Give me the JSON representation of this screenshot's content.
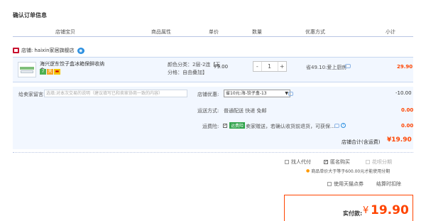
{
  "page": {
    "title": "确认订单信息"
  },
  "header": {
    "columns": [
      "店铺宝贝",
      "商品属性",
      "单价",
      "数量",
      "优惠方式",
      "小计"
    ]
  },
  "shop": {
    "label": "店铺:",
    "name": "haixin家居旗舰店"
  },
  "item": {
    "name": "海兴逻东饺子盒冰箱保鲜收纳盒...",
    "badges": [
      "7",
      "天",
      "▬"
    ],
    "attr": "颜色分类：2层-2连【无分格：自由叠加】",
    "price": "79.00",
    "qty": "1",
    "qty_minus": "-",
    "qty_plus": "+",
    "promo": "省49.10:爱上厨房",
    "subtotal": "29.90"
  },
  "options": {
    "message_label": "给卖家留言:",
    "message_placeholder": "选填:对本次交易的说明（建议填写已和卖家协商一致的内容）",
    "coupon_label": "店铺优惠:",
    "coupon_value": "省10元:海-饺子盒-13",
    "coupon_amount": "-10.00",
    "shipping_label": "运送方式:",
    "shipping_value": "普通配送 快递 免邮",
    "shipping_amount": "0.00",
    "insurance_label": "运费险:",
    "insurance_badge": "运费险",
    "insurance_text": "卖家赠送，若确认收货前退货，可获保...",
    "insurance_amount": "0.00",
    "insurance_help": "?"
  },
  "total": {
    "label": "店铺合计(含运费)",
    "value": "¥19.90"
  },
  "extras": {
    "proxy_pay": "找人代付",
    "anonymous": "匿名购买",
    "installment": "花呗分期",
    "installment_note": "商品单价大于等于600.00元才能使用分期",
    "tmall_coupon": "使用天猫点券",
    "pay_points": "结算时扣除"
  },
  "summary": {
    "label": "实付款:",
    "currency": "¥",
    "value": "19.90"
  },
  "colors": {
    "accent": "#ff4400",
    "header_line": "#b9c6e4",
    "row_bg": "#f2f7ff"
  },
  "icons": [
    "shop-icon",
    "wangwang-icon",
    "chat-icon",
    "dropdown-arrow-icon",
    "help-icon",
    "location-pin-icon"
  ]
}
